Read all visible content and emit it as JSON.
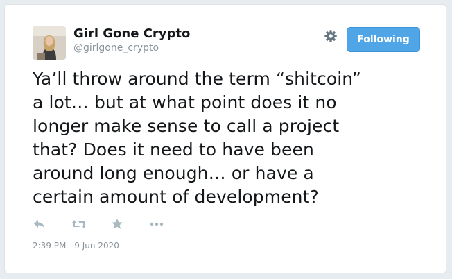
{
  "author": {
    "name": "Girl Gone Crypto",
    "handle": "@girlgone_crypto"
  },
  "header": {
    "follow_label": "Following"
  },
  "tweet": {
    "lines": [
      "Ya’ll throw around the term “shitcoin”",
      "a lot… but at what point does it no",
      "longer make sense to call a project",
      "that?  Does it need to have been",
      "around long enough… or have a",
      "certain amount of development?"
    ],
    "timestamp": "2:39 PM - 9 Jun 2020"
  },
  "actions": {
    "icons": [
      "reply-icon",
      "retweet-icon",
      "like-icon",
      "more-icon"
    ]
  },
  "colors": {
    "accent": "#50a5e6",
    "action_icon": "#aab8c2",
    "text": "#14171a",
    "muted": "#8a939b"
  }
}
